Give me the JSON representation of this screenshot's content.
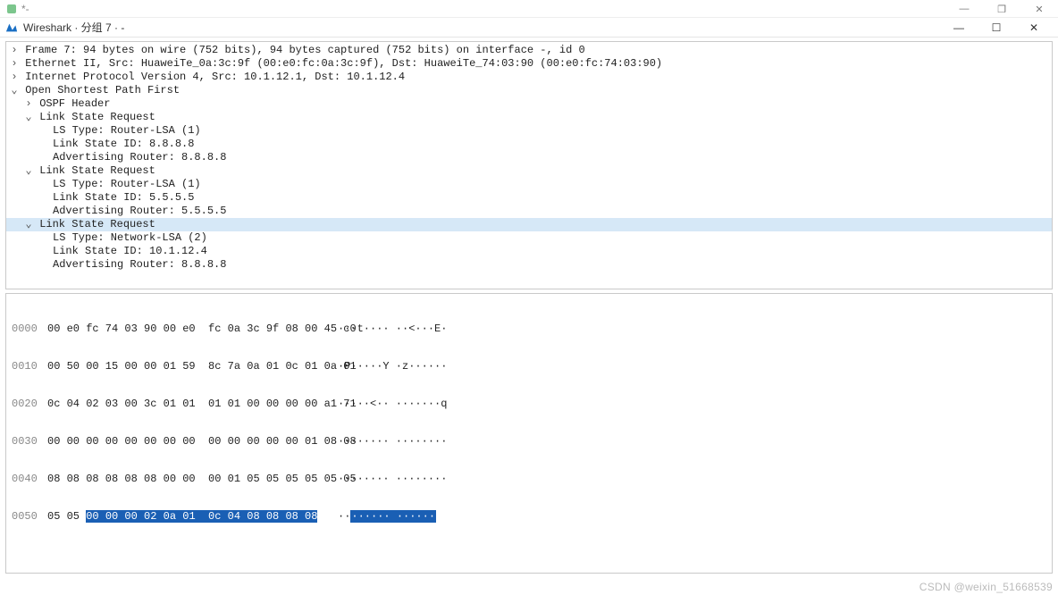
{
  "outer_window": {
    "title": "*-"
  },
  "app": {
    "title": "Wireshark · 分组 7 · -",
    "min": "—",
    "max": "☐",
    "close": "✕"
  },
  "outer_controls": {
    "min": "—",
    "max": "❐",
    "close": "✕"
  },
  "tree": {
    "frame": "Frame 7: 94 bytes on wire (752 bits), 94 bytes captured (752 bits) on interface -, id 0",
    "eth": "Ethernet II, Src: HuaweiTe_0a:3c:9f (00:e0:fc:0a:3c:9f), Dst: HuaweiTe_74:03:90 (00:e0:fc:74:03:90)",
    "ip": "Internet Protocol Version 4, Src: 10.1.12.1, Dst: 10.1.12.4",
    "ospf": "Open Shortest Path First",
    "ospf_hdr": "OSPF Header",
    "lsr1": "Link State Request",
    "lsr1_type": "LS Type: Router-LSA (1)",
    "lsr1_id": "Link State ID: 8.8.8.8",
    "lsr1_adv": "Advertising Router: 8.8.8.8",
    "lsr2": "Link State Request",
    "lsr2_type": "LS Type: Router-LSA (1)",
    "lsr2_id": "Link State ID: 5.5.5.5",
    "lsr2_adv": "Advertising Router: 5.5.5.5",
    "lsr3": "Link State Request",
    "lsr3_type": "LS Type: Network-LSA (2)",
    "lsr3_id": "Link State ID: 10.1.12.4",
    "lsr3_adv": "Advertising Router: 8.8.8.8"
  },
  "hex": {
    "r0": {
      "off": "0000",
      "b": "00 e0 fc 74 03 90 00 e0  fc 0a 3c 9f 08 00 45 c0",
      "a": "···t···· ··<···E·"
    },
    "r1": {
      "off": "0010",
      "b": "00 50 00 15 00 00 01 59  8c 7a 0a 01 0c 01 0a 01",
      "a": "·P·····Y ·z······"
    },
    "r2": {
      "off": "0020",
      "b": "0c 04 02 03 00 3c 01 01  01 01 00 00 00 00 a1 71",
      "a": "·····<·· ·······q"
    },
    "r3": {
      "off": "0030",
      "b": "00 00 00 00 00 00 00 00  00 00 00 00 00 01 08 08",
      "a": "········ ········"
    },
    "r4": {
      "off": "0040",
      "b": "08 08 08 08 08 08 00 00  00 01 05 05 05 05 05 05",
      "a": "········ ········"
    },
    "r5": {
      "off": "0050",
      "b_plain": "05 05 ",
      "b_sel": "00 00 00 02 0a 01  0c 04 08 08 08 08",
      "a_plain": "··",
      "a_sel": "······ ······"
    }
  },
  "watermark": "CSDN @weixin_51668539"
}
